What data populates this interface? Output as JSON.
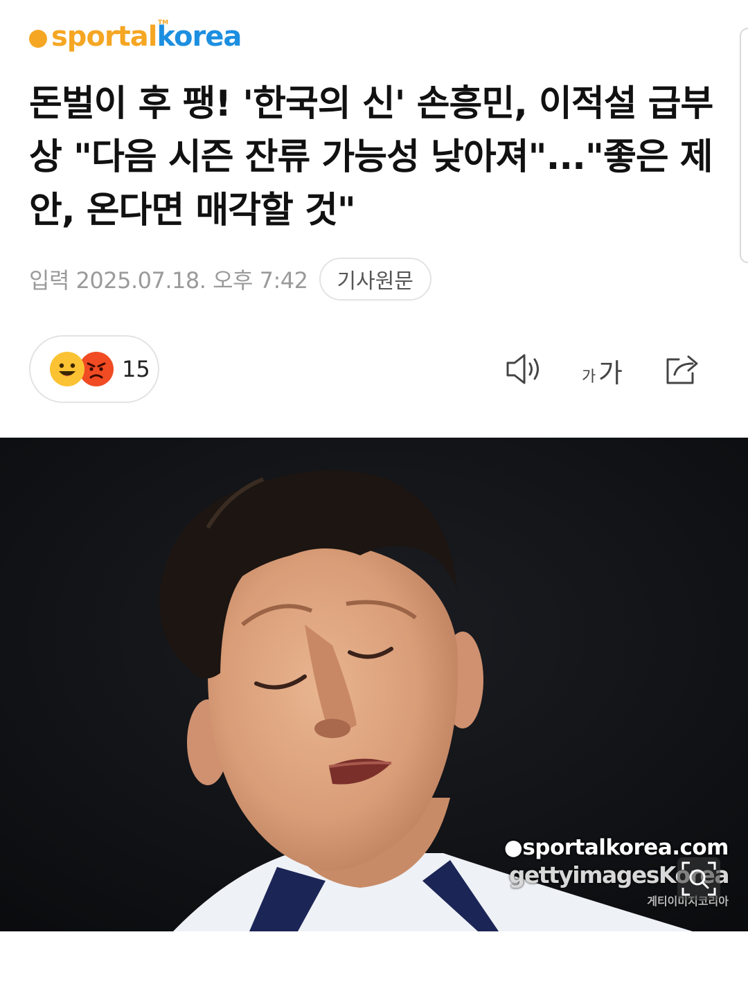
{
  "publisher": {
    "logo_part1": "sportal",
    "logo_part2": "korea",
    "logo_tm": "TM"
  },
  "article": {
    "headline": "돈벌이 후 팽! '한국의 신' 손흥민, 이적설 급부상 \"다음 시즌 잔류 가능성 낮아져\"...\"좋은 제안, 온다면 매각할 것\"",
    "published": "입력 2025.07.18. 오후 7:42",
    "original_link_label": "기사원문"
  },
  "reactions": {
    "count": "15",
    "emojis": [
      "happy-emoji",
      "angry-emoji"
    ]
  },
  "toolbar": {
    "tts_icon": "speaker-icon",
    "font_icon": "font-size-icon",
    "font_small": "가",
    "font_large": "가",
    "share_icon": "share-icon"
  },
  "photo": {
    "watermark_sportal": "●sportalkorea.com",
    "watermark_getty": "gettyimagesKorea",
    "watermark_getty_kr": "게티이미지코리아",
    "zoom_icon": "zoom-icon"
  },
  "colors": {
    "brand_orange": "#f5a623",
    "brand_blue": "#1d8fe0",
    "meta_gray": "#9a9a9a",
    "border_gray": "#e3e3e3"
  }
}
